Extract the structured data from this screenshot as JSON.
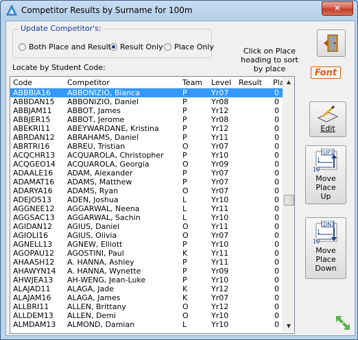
{
  "window": {
    "title": "Competitor Results by Surname for 100m",
    "close_label": "✕"
  },
  "update_group": {
    "legend": "Update Competitor's:",
    "options": [
      {
        "label": "Both Place and Result",
        "selected": false
      },
      {
        "label": "Result Only",
        "selected": true
      },
      {
        "label": "Place Only",
        "selected": false
      }
    ]
  },
  "hint": "Click on Place heading to sort by place",
  "locate_label": "Locate by Student Code:",
  "buttons": {
    "font": "Font",
    "edit": "Edit",
    "move_up": "Move Place Up",
    "move_down": "Move Place Down",
    "up_badge": "UP1",
    "down_badge": "DN1",
    "one": "1",
    "ten": "10"
  },
  "table": {
    "columns": [
      "Code",
      "Competitor",
      "Team",
      "Level",
      "Result",
      "Pla"
    ],
    "rows": [
      [
        "ABBBIA16",
        "ABBONIZIO, Bianca",
        "P",
        "Yr07",
        "",
        "0"
      ],
      [
        "ABBDAN15",
        "ABBONIZIO, Daniel",
        "P",
        "Yr08",
        "",
        "0"
      ],
      [
        "ABBJAM11",
        "ABBOT, James",
        "P",
        "Yr12",
        "",
        "0"
      ],
      [
        "ABBJER15",
        "ABBOT, Jerome",
        "P",
        "Yr08",
        "",
        "0"
      ],
      [
        "ABEKRI11",
        "ABEYWARDANE, Kristina",
        "P",
        "Yr12",
        "",
        "0"
      ],
      [
        "ABRDAN12",
        "ABRAHAMS, Daniel",
        "P",
        "Yr11",
        "",
        "0"
      ],
      [
        "ABRTRI16",
        "ABREU, Tristian",
        "O",
        "Yr07",
        "",
        "0"
      ],
      [
        "ACQCHR13",
        "ACQUAROLA, Christopher",
        "P",
        "Yr10",
        "",
        "0"
      ],
      [
        "ACQGEO14",
        "ACQUAROLA, Georgia",
        "O",
        "Yr09",
        "",
        "0"
      ],
      [
        "ADAALE16",
        "ADAM, Alexander",
        "P",
        "Yr07",
        "",
        "0"
      ],
      [
        "ADAMAT16",
        "ADAMS, Matthew",
        "P",
        "Yr07",
        "",
        "0"
      ],
      [
        "ADARYA16",
        "ADAMS, Ryan",
        "O",
        "Yr07",
        "",
        "0"
      ],
      [
        "ADEJOS13",
        "ADEN, Joshua",
        "L",
        "Yr10",
        "",
        "0"
      ],
      [
        "AGGNEE12",
        "AGGARWAL, Neena",
        "L",
        "Yr11",
        "",
        "0"
      ],
      [
        "AGGSAC13",
        "AGGARWAL, Sachin",
        "L",
        "Yr10",
        "",
        "0"
      ],
      [
        "AGIDAN12",
        "AGIUS, Daniel",
        "O",
        "Yr11",
        "",
        "0"
      ],
      [
        "AGIOLI16",
        "AGIUS, Olivia",
        "O",
        "Yr07",
        "",
        "0"
      ],
      [
        "AGNELL13",
        "AGNEW, Elliott",
        "P",
        "Yr10",
        "",
        "0"
      ],
      [
        "AGOPAU12",
        "AGOSTINI, Paul",
        "K",
        "Yr11",
        "",
        "0"
      ],
      [
        "AHAASH12",
        "A. HANNA, Ashley",
        "P",
        "Yr11",
        "",
        "0"
      ],
      [
        "AHAWYN14",
        "A. HANNA, Wynette",
        "P",
        "Yr09",
        "",
        "0"
      ],
      [
        "AHWJEA13",
        "AH-WENG, Jean-Luke",
        "P",
        "Yr10",
        "",
        "0"
      ],
      [
        "ALAJAD11",
        "ALAGA, Jade",
        "K",
        "Yr12",
        "",
        "0"
      ],
      [
        "ALAJAM16",
        "ALAGA, James",
        "K",
        "Yr07",
        "",
        "0"
      ],
      [
        "ALLBRI11",
        "ALLEN, Brittany",
        "O",
        "Yr12",
        "",
        "0"
      ],
      [
        "ALLDEM13",
        "ALLEN, Demi",
        "O",
        "Yr10",
        "",
        "0"
      ],
      [
        "ALMDAM13",
        "ALMOND, Damian",
        "L",
        "Yr10",
        "",
        "0"
      ]
    ]
  },
  "colors": {
    "selection": "#3399ff",
    "legend_text": "#1a3a9a",
    "font_badge": "#e06010"
  }
}
